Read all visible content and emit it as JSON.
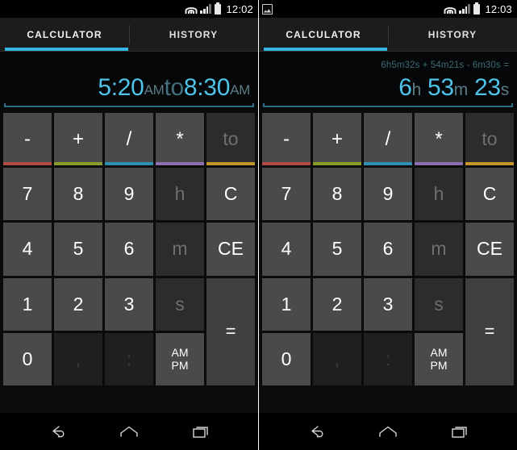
{
  "colors": {
    "accent_cyan": "#33b5e5",
    "display_number": "#4fc3e8",
    "display_unit": "#5a7c86",
    "display_expression": "#3f6b72",
    "key_face": "#4a4a4a",
    "key_disabled": "#2c2c2c",
    "op_minus_accent": "#b34a4a",
    "op_plus_accent": "#8a9a2b",
    "op_divide_accent": "#2f8fb3",
    "op_multiply_accent": "#8b6fae",
    "op_to_accent": "#c29429"
  },
  "panels": [
    {
      "id": "left",
      "status_bar": {
        "notification_icon": null,
        "wifi_icon": "wifi-icon",
        "signal_icon": "signal-icon",
        "battery_icon": "battery-icon",
        "clock": "12:02"
      },
      "tabs": [
        {
          "label": "CALCULATOR",
          "active": true
        },
        {
          "label": "HISTORY",
          "active": false
        }
      ],
      "display": {
        "expression": "",
        "segments": [
          {
            "text": "5:20",
            "kind": "number"
          },
          {
            "text": "AM",
            "kind": "unit-small"
          },
          {
            "text": "to",
            "kind": "word"
          },
          {
            "text": "8:30",
            "kind": "number"
          },
          {
            "text": "AM",
            "kind": "unit-small"
          }
        ]
      }
    },
    {
      "id": "right",
      "status_bar": {
        "notification_icon": "screenshot-icon",
        "wifi_icon": "wifi-icon",
        "signal_icon": "signal-icon",
        "battery_icon": "battery-icon",
        "clock": "12:03"
      },
      "tabs": [
        {
          "label": "CALCULATOR",
          "active": true
        },
        {
          "label": "HISTORY",
          "active": false
        }
      ],
      "display": {
        "expression": "6h5m32s + 54m21s - 6m30s =",
        "segments": [
          {
            "text": "6",
            "kind": "number"
          },
          {
            "text": "h",
            "kind": "unit"
          },
          {
            "text": " 53",
            "kind": "number"
          },
          {
            "text": "m",
            "kind": "unit"
          },
          {
            "text": " 23",
            "kind": "number"
          },
          {
            "text": "s",
            "kind": "unit"
          }
        ]
      }
    }
  ],
  "keypad": {
    "rows": [
      [
        {
          "label": "-",
          "name": "key-minus",
          "state": "op",
          "accent": "#b34a4a"
        },
        {
          "label": "+",
          "name": "key-plus",
          "state": "op",
          "accent": "#8a9a2b"
        },
        {
          "label": "/",
          "name": "key-divide",
          "state": "op",
          "accent": "#2f8fb3"
        },
        {
          "label": "*",
          "name": "key-multiply",
          "state": "op",
          "accent": "#8b6fae"
        },
        {
          "label": "to",
          "name": "key-to",
          "state": "disabled",
          "accent": "#c29429"
        }
      ],
      [
        {
          "label": "7",
          "name": "key-7",
          "state": "normal"
        },
        {
          "label": "8",
          "name": "key-8",
          "state": "normal"
        },
        {
          "label": "9",
          "name": "key-9",
          "state": "normal"
        },
        {
          "label": "h",
          "name": "key-hours",
          "state": "disabled"
        },
        {
          "label": "C",
          "name": "key-clear",
          "state": "normal"
        }
      ],
      [
        {
          "label": "4",
          "name": "key-4",
          "state": "normal"
        },
        {
          "label": "5",
          "name": "key-5",
          "state": "normal"
        },
        {
          "label": "6",
          "name": "key-6",
          "state": "normal"
        },
        {
          "label": "m",
          "name": "key-minutes",
          "state": "disabled"
        },
        {
          "label": "CE",
          "name": "key-clear-entry",
          "state": "normal"
        }
      ],
      [
        {
          "label": "1",
          "name": "key-1",
          "state": "normal"
        },
        {
          "label": "2",
          "name": "key-2",
          "state": "normal"
        },
        {
          "label": "3",
          "name": "key-3",
          "state": "normal"
        },
        {
          "label": "s",
          "name": "key-seconds",
          "state": "disabled"
        },
        {
          "label": "=",
          "name": "key-equals",
          "state": "equals"
        }
      ],
      [
        {
          "label": "0",
          "name": "key-0",
          "state": "normal"
        },
        {
          "label": ",",
          "name": "key-comma",
          "state": "vdark"
        },
        {
          "label": ":",
          "name": "key-colon",
          "state": "vdark"
        },
        {
          "label": "AM\nPM",
          "name": "key-ampm",
          "state": "ampm"
        }
      ]
    ]
  },
  "navbar": {
    "back_label": "back-icon",
    "home_label": "home-icon",
    "recents_label": "recents-icon"
  }
}
